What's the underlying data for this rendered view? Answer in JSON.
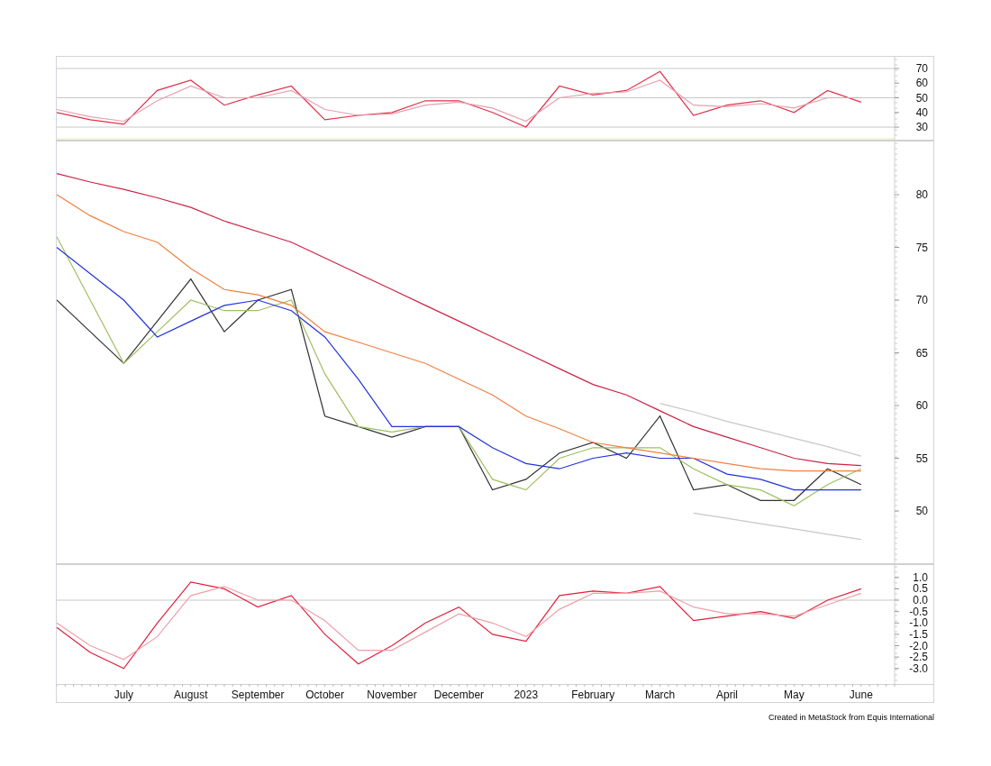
{
  "charts": [
    {
      "kind": "oscillator",
      "chart_data": {
        "type": "line",
        "grid": true,
        "categories": [
          null,
          null,
          null,
          null,
          null,
          null,
          null,
          null,
          null,
          null,
          null,
          null,
          null,
          null,
          null,
          null,
          null,
          null,
          null,
          null,
          null,
          null,
          null,
          null,
          null
        ],
        "ylim": [
          20.8,
          78
        ],
        "yticks": [
          30,
          40,
          50,
          60,
          70
        ],
        "series": [
          {
            "color": "#e0304a",
            "values": [
              40,
              35,
              32,
              55,
              62,
              45,
              52,
              58,
              35,
              38,
              40,
              48,
              48,
              40,
              30,
              58,
              52,
              55,
              68,
              38,
              45,
              48,
              40,
              55,
              47
            ]
          },
          {
            "color": "#e8a0b0",
            "values": [
              42,
              37,
              34,
              48,
              58,
              50,
              50,
              55,
              42,
              38,
              39,
              45,
              47,
              43,
              34,
              50,
              53,
              54,
              62,
              45,
              44,
              46,
              43,
              50,
              50
            ]
          }
        ]
      }
    },
    {
      "kind": "price",
      "chart_data": {
        "type": "line",
        "categories": [
          null,
          null,
          null,
          null,
          null,
          null,
          null,
          null,
          null,
          null,
          null,
          null,
          null,
          null,
          null,
          null,
          null,
          null,
          null,
          null,
          null,
          null,
          null,
          null,
          null
        ],
        "ylim": [
          44.96,
          85.13
        ],
        "yticks": [
          50,
          55,
          60,
          65,
          70,
          75,
          80
        ],
        "series": [
          {
            "color": "#333333",
            "values": [
              70,
              67,
              64,
              68,
              72,
              67,
              70,
              71,
              59,
              58,
              57,
              58,
              58,
              52,
              53,
              55.5,
              56.5,
              55,
              59,
              52,
              52.5,
              51,
              51,
              54,
              52.5
            ]
          },
          {
            "color": "#9dc060",
            "values": [
              76,
              70,
              64,
              67,
              70,
              69,
              69,
              70,
              63,
              58,
              57.5,
              58,
              58,
              53,
              52,
              55,
              56,
              56,
              56,
              54,
              52.5,
              52,
              50.5,
              52.5,
              54
            ]
          },
          {
            "color": "#2233dd",
            "values": [
              75,
              72.5,
              70,
              66.5,
              68,
              69.5,
              70,
              69,
              66.5,
              62.5,
              58,
              58,
              58,
              56,
              54.5,
              54,
              55,
              55.5,
              55,
              55,
              53.5,
              53,
              52,
              52,
              52
            ]
          },
          {
            "color": "#f08040",
            "values": [
              80,
              78,
              76.5,
              75.5,
              73,
              71,
              70.5,
              69.5,
              67,
              66,
              65,
              64,
              62.5,
              61,
              59,
              57.8,
              56.5,
              56,
              55.5,
              55,
              54.5,
              54,
              53.8,
              53.8,
              53.8
            ]
          },
          {
            "color": "#cc2244",
            "values": [
              82,
              81.2,
              80.5,
              79.7,
              78.8,
              77.5,
              76.5,
              75.5,
              74,
              72.5,
              71,
              69.5,
              68,
              66.5,
              65,
              63.5,
              62,
              61,
              59.5,
              58,
              57,
              56,
              55,
              54.5,
              54.3
            ]
          },
          {
            "color": "#c8c8c8",
            "values": [
              null,
              null,
              null,
              null,
              null,
              null,
              null,
              null,
              null,
              null,
              null,
              null,
              null,
              null,
              null,
              null,
              null,
              null,
              60.2,
              59.4,
              58.5,
              57.7,
              56.9,
              56.1,
              55.2
            ]
          },
          {
            "color": "#c8c8c8",
            "values": [
              null,
              null,
              null,
              null,
              null,
              null,
              null,
              null,
              null,
              null,
              null,
              null,
              null,
              null,
              null,
              null,
              null,
              null,
              null,
              49.8,
              49.3,
              48.8,
              48.3,
              47.8,
              47.3
            ]
          }
        ]
      }
    },
    {
      "kind": "oscillator",
      "chart_data": {
        "type": "line",
        "categories": [
          null,
          null,
          "July",
          null,
          "August",
          null,
          "September",
          null,
          "October",
          null,
          "November",
          null,
          "December",
          null,
          "2023",
          null,
          "February",
          null,
          "March",
          null,
          "April",
          null,
          "May",
          null,
          "June"
        ],
        "ylim": [
          -3.683,
          1.584
        ],
        "yticks": [
          {
            "value": 1,
            "label": "1.0"
          },
          {
            "value": 0.5,
            "label": "0.5"
          },
          {
            "value": 0,
            "label": "0.0"
          },
          {
            "value": -0.5,
            "label": "-0.5"
          },
          {
            "value": -1,
            "label": "-1.0"
          },
          {
            "value": -1.5,
            "label": "-1.5"
          },
          {
            "value": -2,
            "label": "-2.0"
          },
          {
            "value": -2.5,
            "label": "-2.5"
          },
          {
            "value": -3,
            "label": "-3.0"
          }
        ],
        "series": [
          {
            "color": "#e0203a",
            "values": [
              -1.2,
              -2.3,
              -3.0,
              -1.0,
              0.8,
              0.5,
              -0.3,
              0.2,
              -1.5,
              -2.8,
              -2.0,
              -1.0,
              -0.3,
              -1.5,
              -1.8,
              0.2,
              0.4,
              0.3,
              0.6,
              -0.9,
              -0.7,
              -0.5,
              -0.8,
              0.0,
              0.5
            ]
          },
          {
            "color": "#f0a0a8",
            "values": [
              -1.0,
              -2.0,
              -2.6,
              -1.6,
              0.2,
              0.6,
              0.0,
              0.0,
              -0.9,
              -2.2,
              -2.2,
              -1.4,
              -0.6,
              -1.0,
              -1.6,
              -0.4,
              0.3,
              0.3,
              0.4,
              -0.3,
              -0.6,
              -0.6,
              -0.7,
              -0.2,
              0.3
            ]
          }
        ]
      }
    }
  ],
  "footer": "Created in MetaStock from Equis International"
}
